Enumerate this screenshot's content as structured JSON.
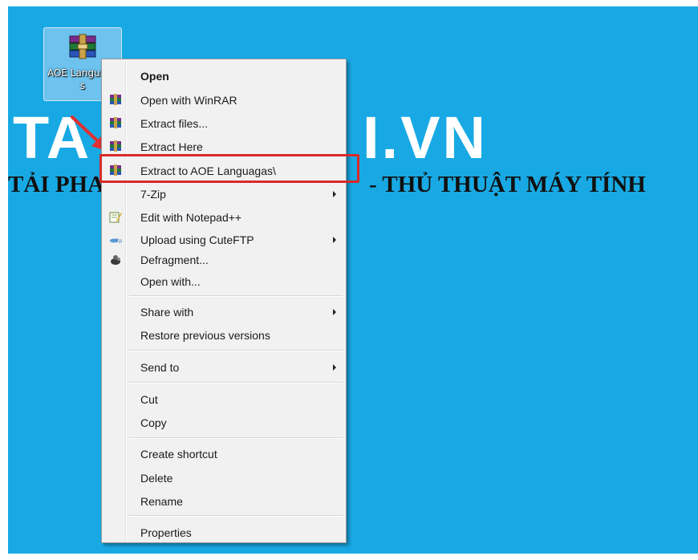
{
  "watermark": {
    "brand_left": "TA",
    "brand_right": "I.VN",
    "tagline_left": "TẢI PHA",
    "tagline_right": "- THỦ THUẬT MÁY TÍNH"
  },
  "desktop_icon": {
    "name": "AOE Languagas",
    "icon": "winrar-archive-icon"
  },
  "context_menu": {
    "items": [
      {
        "label": "Open",
        "icon": "",
        "bold": true
      },
      {
        "label": "Open with WinRAR",
        "icon": "winrar-icon"
      },
      {
        "label": "Extract files...",
        "icon": "winrar-icon"
      },
      {
        "label": "Extract Here",
        "icon": "winrar-icon"
      },
      {
        "label": "Extract to AOE Languagas\\",
        "icon": "winrar-icon",
        "highlighted": true
      },
      {
        "label": "7-Zip",
        "submenu": true
      },
      {
        "label": "Edit with Notepad++",
        "icon": "notepadpp-icon"
      },
      {
        "label": "Upload using CuteFTP",
        "icon": "cuteftp-icon",
        "submenu": true
      },
      {
        "label": "Defragment...",
        "icon": "defrag-icon"
      },
      {
        "label": "Open with..."
      },
      {
        "label": "Share with",
        "submenu": true
      },
      {
        "label": "Restore previous versions"
      },
      {
        "label": "Send to",
        "submenu": true
      },
      {
        "label": "Cut"
      },
      {
        "label": "Copy"
      },
      {
        "label": "Create shortcut"
      },
      {
        "label": "Delete"
      },
      {
        "label": "Rename"
      },
      {
        "label": "Properties"
      }
    ]
  },
  "colors": {
    "desktop_background": "#18a9e4",
    "highlight_border": "#d72a2a",
    "arrow": "#e03030"
  }
}
